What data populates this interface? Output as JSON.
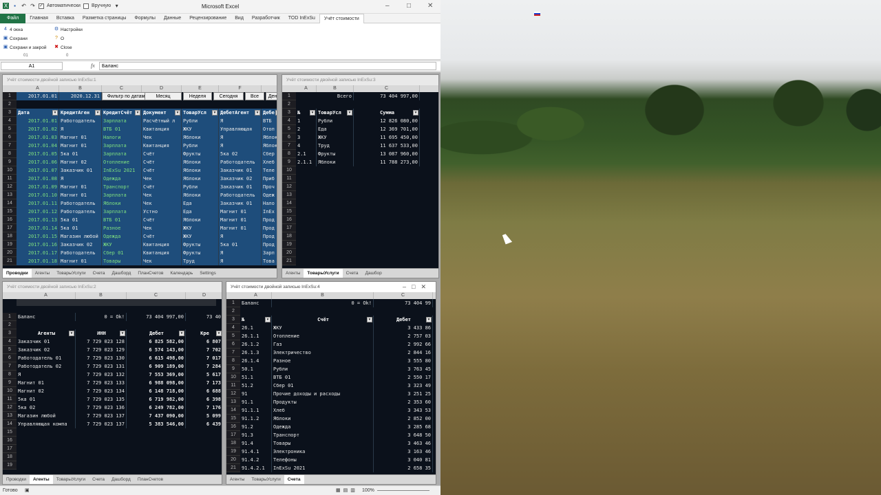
{
  "app": {
    "title": "Microsoft Excel"
  },
  "qat": {
    "calc_auto": "Автоматически",
    "calc_manual": "Вручную"
  },
  "ribbon_tabs": [
    "Файл",
    "Главная",
    "Вставка",
    "Разметка страницы",
    "Формулы",
    "Данные",
    "Рецензирование",
    "Вид",
    "Разработчик",
    "TOD InExSu",
    "Учёт стоимости"
  ],
  "ribbon": {
    "windows": "4 окна",
    "save": "Сохрани",
    "save_close": "Сохрани и закрой",
    "settings": "Настройки",
    "about": "О",
    "close": "Close",
    "group1": "01",
    "group2": "0"
  },
  "formula_bar": {
    "name_box": "A1",
    "fx": "fx",
    "value": "Баланс"
  },
  "w1": {
    "title": "Учёт стоимости двойной записью InExSu:1",
    "cols": [
      "A",
      "B",
      "C",
      "D",
      "E",
      "F",
      ""
    ],
    "r1": {
      "a": "2017.01.01",
      "b": "2020.12.31"
    },
    "buttons": [
      "Фильтр по датам",
      "Месяц",
      "Неделя",
      "Сегодня",
      "Все",
      "Ден"
    ],
    "headers": [
      "Дата",
      "КредитАген",
      "КредитСчёт",
      "Документ",
      "ТоварУсл",
      "ДебетАгент",
      "Дебе"
    ],
    "rows": [
      [
        "2017.01.01",
        "Работодатель",
        "Зарплата",
        "Расчётный л",
        "Рубли",
        "Я",
        "ВТБ"
      ],
      [
        "2017.01.02",
        "Я",
        "ВТБ 01",
        "Квитанция",
        "ЖКУ",
        "Управляющая",
        "Отоп"
      ],
      [
        "2017.01.03",
        "Магнит 01",
        "Налоги",
        "Чек",
        "Яблоки",
        "Я",
        "Яблок"
      ],
      [
        "2017.01.04",
        "Магнит 01",
        "Зарплата",
        "Квитанция",
        "Рубли",
        "Я",
        "Яблок"
      ],
      [
        "2017.01.05",
        "5ка 01",
        "Зарплата",
        "Счёт",
        "Фрукты",
        "5ка 02",
        "Сбер"
      ],
      [
        "2017.01.06",
        "Магнит 02",
        "Отопление",
        "Счёт",
        "Яблоки",
        "Работодатель",
        "Хлеб"
      ],
      [
        "2017.01.07",
        "Заказчик 01",
        "InExSu 2021",
        "Счёт",
        "Яблоки",
        "Заказчик 01",
        "Теле"
      ],
      [
        "2017.01.08",
        "Я",
        "Одежда",
        "Чек",
        "Яблоки",
        "Заказчик 02",
        "Приб"
      ],
      [
        "2017.01.09",
        "Магнит 01",
        "Транспорт",
        "Счёт",
        "Рубли",
        "Заказчик 01",
        "Проч"
      ],
      [
        "2017.01.10",
        "Магнит 01",
        "Зарплата",
        "Чек",
        "Яблоки",
        "Работодатель",
        "Одеж"
      ],
      [
        "2017.01.11",
        "Работодатель",
        "Яблоки",
        "Чек",
        "Еда",
        "Заказчик 01",
        "Нало"
      ],
      [
        "2017.01.12",
        "Работодатель",
        "Зарплата",
        "Устно",
        "Еда",
        "Магнит 01",
        "InEx"
      ],
      [
        "2017.01.13",
        "5ка 01",
        "ВТБ 01",
        "Счёт",
        "Яблоки",
        "Магнит 01",
        "Прод"
      ],
      [
        "2017.01.14",
        "5ка 01",
        "Разное",
        "Чек",
        "ЖКУ",
        "Магнит 01",
        "Прод"
      ],
      [
        "2017.01.15",
        "Магазин любой",
        "Одежда",
        "Счёт",
        "ЖКУ",
        "Я",
        "Прод"
      ],
      [
        "2017.01.16",
        "Заказчик 02",
        "ЖКУ",
        "Квитанция",
        "Фрукты",
        "5ка 01",
        "Прод"
      ],
      [
        "2017.01.17",
        "Работодатель",
        "Сбер 01",
        "Квитанция",
        "Фрукты",
        "Я",
        "Зарп"
      ],
      [
        "2017.01.18",
        "Магнит 01",
        "Товары",
        "Чек",
        "Труд",
        "Я",
        "Това"
      ]
    ],
    "tabs": [
      "Проводки",
      "Агенты",
      "ТоварыУслуги",
      "Счета",
      "Дашборд",
      "ПланСчетов",
      "Календарь",
      "Settings"
    ]
  },
  "w3": {
    "title": "Учёт стоимости двойной записью InExSu:3",
    "cols": [
      "A",
      "B",
      "C"
    ],
    "total_label": "Всего",
    "total": "73 404 997,00",
    "headers": [
      "№",
      "ТоварУсл",
      "Сумма"
    ],
    "rows": [
      [
        "1",
        "Рубли",
        "12 826 080,00"
      ],
      [
        "2",
        "Еда",
        "12 369 701,00"
      ],
      [
        "3",
        "ЖКУ",
        "11 695 450,00"
      ],
      [
        "4",
        "Труд",
        "11 637 533,00"
      ],
      [
        "2.1",
        "Фрукты",
        "13 087 960,00"
      ],
      [
        "2.1.1",
        "Яблоки",
        "11 788 273,00"
      ]
    ],
    "tabs": [
      "Агенты",
      "ТоварыУслуги",
      "Счета",
      "Дашбор"
    ]
  },
  "w2": {
    "title": "Учёт стоимости двойной записью InExSu:2",
    "cols": [
      "A",
      "B",
      "C",
      "D"
    ],
    "r1": [
      "Баланс",
      "0 = Ok!",
      "73 404 997,00",
      "73 40"
    ],
    "headers": [
      "Агенты",
      "ИНН",
      "Дебет",
      "Кре"
    ],
    "rows": [
      [
        "Заказчик 01",
        "7 729 023 128",
        "6 825 582,00",
        "6 807"
      ],
      [
        "Заказчик 02",
        "7 729 023 129",
        "6 574 143,00",
        "7 702"
      ],
      [
        "Работодатель 01",
        "7 729 023 130",
        "6 615 498,00",
        "7 017"
      ],
      [
        "Работодатель 02",
        "7 729 023 131",
        "6 909 189,00",
        "7 284"
      ],
      [
        "Я",
        "7 729 023 132",
        "7 553 369,00",
        "5 617"
      ],
      [
        "Магнит 01",
        "7 729 023 133",
        "6 988 098,00",
        "7 173"
      ],
      [
        "Магнит 02",
        "7 729 023 134",
        "6 148 718,00",
        "6 688"
      ],
      [
        "5ка 01",
        "7 729 023 135",
        "6 719 982,00",
        "6 398"
      ],
      [
        "5ка 02",
        "7 729 023 136",
        "6 249 782,00",
        "7 176"
      ],
      [
        "Магазин любой",
        "7 729 023 137",
        "7 437 090,00",
        "5 099"
      ],
      [
        "Управляющая компа",
        "7 729 023 137",
        "5 383 546,00",
        "6 439"
      ]
    ],
    "tabs": [
      "Проводки",
      "Агенты",
      "ТоварыУслуги",
      "Счета",
      "Дашборд",
      "ПланСчетов"
    ]
  },
  "w4": {
    "title": "Учёт стоимости двойной записью InExSu:4",
    "cols": [
      "A",
      "B",
      "C"
    ],
    "r1": [
      "Баланс",
      "0 = Ok!",
      "73 404 99"
    ],
    "headers": [
      "№",
      "Счёт",
      "Дебет"
    ],
    "rows": [
      [
        "26.1",
        "ЖКУ",
        "3 433 86"
      ],
      [
        "26.1.1",
        "Отопление",
        "2 757 03"
      ],
      [
        "26.1.2",
        "Газ",
        "2 992 66"
      ],
      [
        "26.1.3",
        "Электричество",
        "2 844 16"
      ],
      [
        "26.1.4",
        "Разное",
        "3 555 80"
      ],
      [
        "50.1",
        "Рубли",
        "3 763 45"
      ],
      [
        "51.1",
        "ВТБ 01",
        "2 550 17"
      ],
      [
        "51.2",
        "Сбер 01",
        "3 323 49"
      ],
      [
        "91",
        "Прочие доходы и расходы",
        "3 251 25"
      ],
      [
        "91.1",
        "Продукты",
        "2 353 60"
      ],
      [
        "91.1.1",
        "Хлеб",
        "3 343 53"
      ],
      [
        "91.1.2",
        "Яблоки",
        "2 852 00"
      ],
      [
        "91.2",
        "Одежда",
        "3 285 68"
      ],
      [
        "91.3",
        "Транспорт",
        "3 648 50"
      ],
      [
        "91.4",
        "Товары",
        "3 463 46"
      ],
      [
        "91.4.1",
        "Электроника",
        "3 163 46"
      ],
      [
        "91.4.2",
        "Телефоны",
        "3 040 81"
      ],
      [
        "91.4.2.1",
        "InExSu 2021",
        "2 658 35"
      ]
    ],
    "tabs": [
      "Агенты",
      "ТоварыУслуги",
      "Счета"
    ]
  },
  "status": {
    "ready": "Готово",
    "zoom": "100%"
  }
}
